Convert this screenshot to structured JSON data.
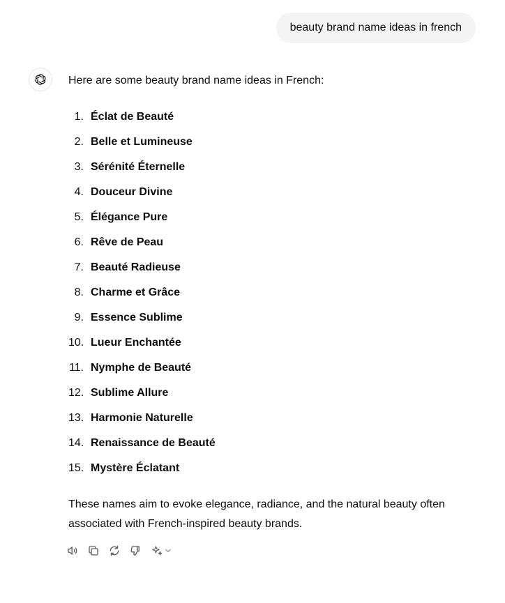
{
  "user_message": "beauty brand name ideas in french",
  "assistant": {
    "intro": "Here are some beauty brand name ideas in French:",
    "names": [
      {
        "num": "1.",
        "name": "Éclat de Beauté"
      },
      {
        "num": "2.",
        "name": "Belle et Lumineuse"
      },
      {
        "num": "3.",
        "name": "Sérénité Éternelle"
      },
      {
        "num": "4.",
        "name": "Douceur Divine"
      },
      {
        "num": "5.",
        "name": "Élégance Pure"
      },
      {
        "num": "6.",
        "name": "Rêve de Peau"
      },
      {
        "num": "7.",
        "name": "Beauté Radieuse"
      },
      {
        "num": "8.",
        "name": "Charme et Grâce"
      },
      {
        "num": "9.",
        "name": "Essence Sublime"
      },
      {
        "num": "10.",
        "name": "Lueur Enchantée"
      },
      {
        "num": "11.",
        "name": "Nymphe de Beauté"
      },
      {
        "num": "12.",
        "name": "Sublime Allure"
      },
      {
        "num": "13.",
        "name": "Harmonie Naturelle"
      },
      {
        "num": "14.",
        "name": "Renaissance de Beauté"
      },
      {
        "num": "15.",
        "name": "Mystère Éclatant"
      }
    ],
    "outro": "These names aim to evoke elegance, radiance, and the natural beauty often associated with French-inspired beauty brands."
  },
  "actions": [
    {
      "icon": "speaker-icon"
    },
    {
      "icon": "copy-icon"
    },
    {
      "icon": "regenerate-icon"
    },
    {
      "icon": "thumbs-down-icon"
    },
    {
      "icon": "sparkle-icon"
    }
  ],
  "colors": {
    "text": "#0d0d0d",
    "bubble_bg": "#f4f4f4",
    "icon": "#5d5d5d"
  }
}
